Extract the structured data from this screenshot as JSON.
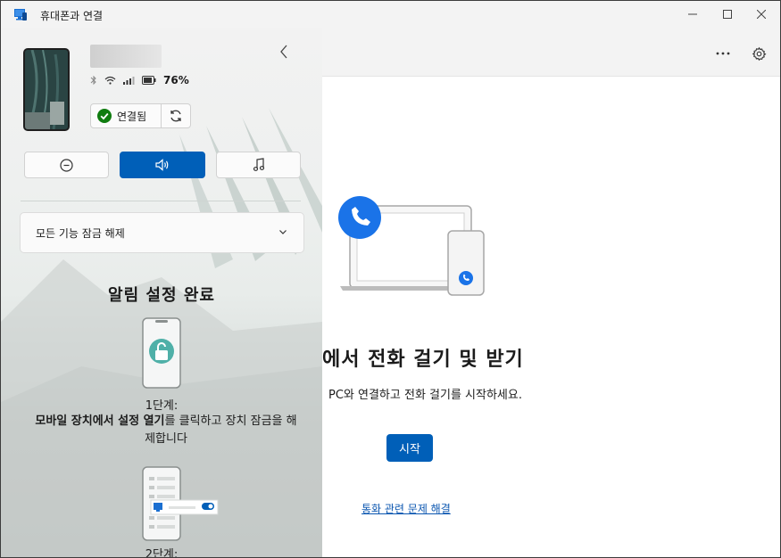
{
  "window": {
    "title": "휴대폰과 연결"
  },
  "device": {
    "battery": "76%",
    "connection_label": "연결됨"
  },
  "unlock": {
    "label": "모든 기능 잠금 해제"
  },
  "notifications": {
    "title": "알림 설정 완료",
    "step1_label": "1단계:",
    "step1_bold": "모바일 장치에서 설정 열기",
    "step1_rest": "를 클릭하고 장치 잠금을 해제합니다",
    "step2_label": "2단계:"
  },
  "main": {
    "heading": "에서 전화 걸기 및 받기",
    "subtitle": "PC와 연결하고 전화 걸기를 시작하세요.",
    "start_button": "시작",
    "troubleshoot_link": "통화 관련 문제 해결"
  },
  "colors": {
    "accent": "#005fb8",
    "connected_green": "#107c10",
    "call_blue": "#1a73e8",
    "link": "#0b56b0"
  },
  "icons": {
    "app": "monitor-phone-icon",
    "bluetooth": "bluetooth-icon",
    "wifi": "wifi-icon",
    "signal": "signal-icon",
    "battery": "battery-icon",
    "collapse": "chevron-left-icon",
    "connected": "check-circle-icon",
    "refresh": "refresh-icon",
    "dnd": "do-not-disturb-icon",
    "sound": "speaker-icon",
    "music": "music-note-icon",
    "dropdown": "chevron-down-icon",
    "more": "more-icon",
    "settings": "gear-icon"
  }
}
